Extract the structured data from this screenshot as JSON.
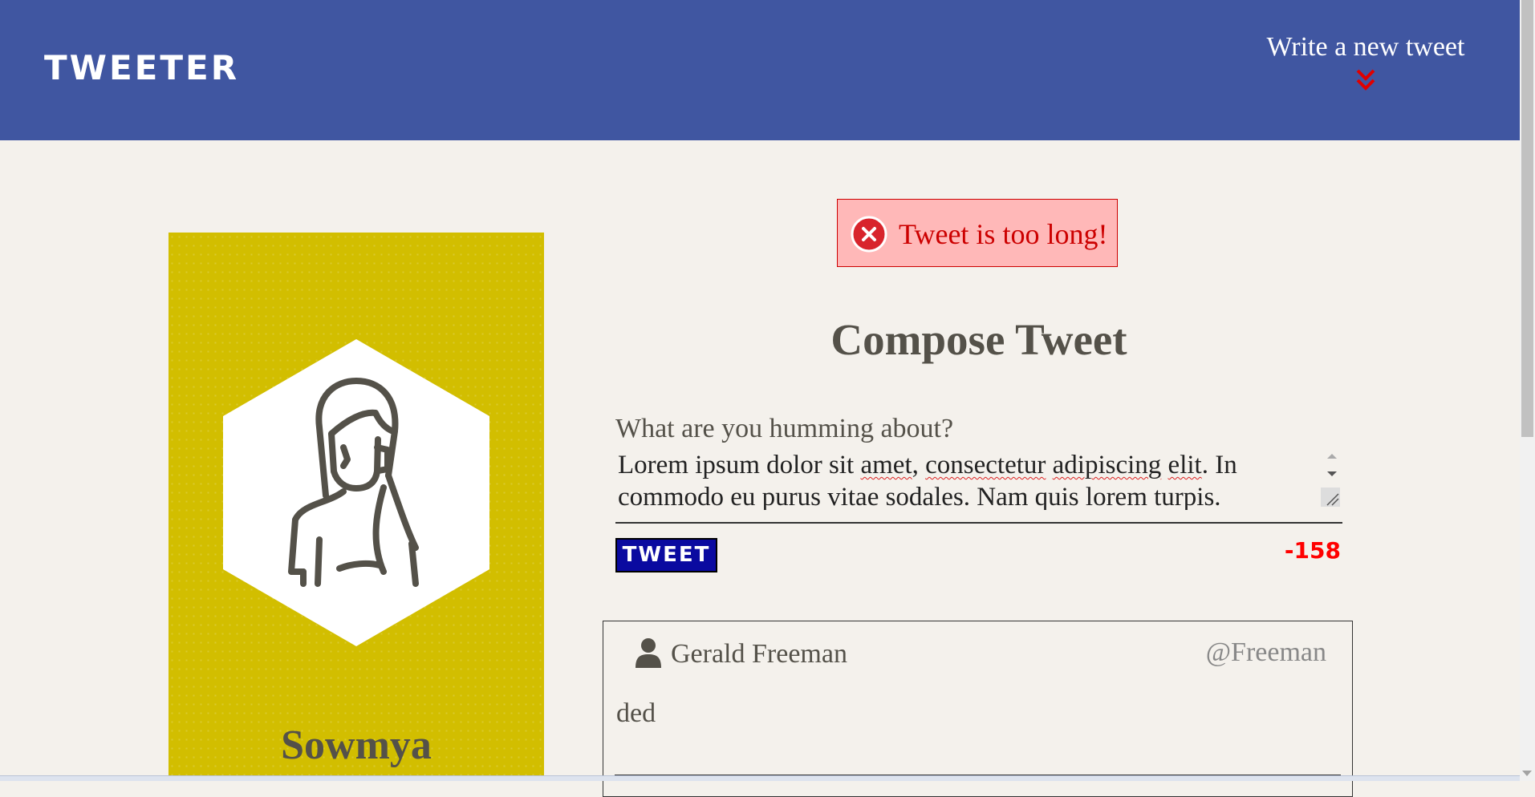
{
  "nav": {
    "brand": "TWEETER",
    "write_label": "Write a new tweet",
    "arrow_color": "#e00000",
    "background_color": "#4056a1"
  },
  "profile": {
    "name": "Sowmya",
    "card_color": "#d2be00",
    "avatar_icon": "woman-avatar-icon"
  },
  "error": {
    "message": "Tweet is too long!",
    "icon": "error-x-icon"
  },
  "compose": {
    "title": "Compose Tweet",
    "prompt": "What are you humming about?",
    "text_segments": {
      "s1": "Lorem ipsum dolor sit ",
      "w1": "amet",
      "s2": ", ",
      "w2": "consectetur",
      "s3": " ",
      "w3": "adipiscing",
      "s4": " ",
      "w4": "elit",
      "s5": ". In commodo eu purus vitae sodales. Nam quis lorem turpis."
    },
    "tweet_button": "TWEET",
    "counter": "-158"
  },
  "tweets": [
    {
      "name": "Gerald Freeman",
      "handle": "@Freeman",
      "content": "ded",
      "icon": "user-icon"
    }
  ]
}
